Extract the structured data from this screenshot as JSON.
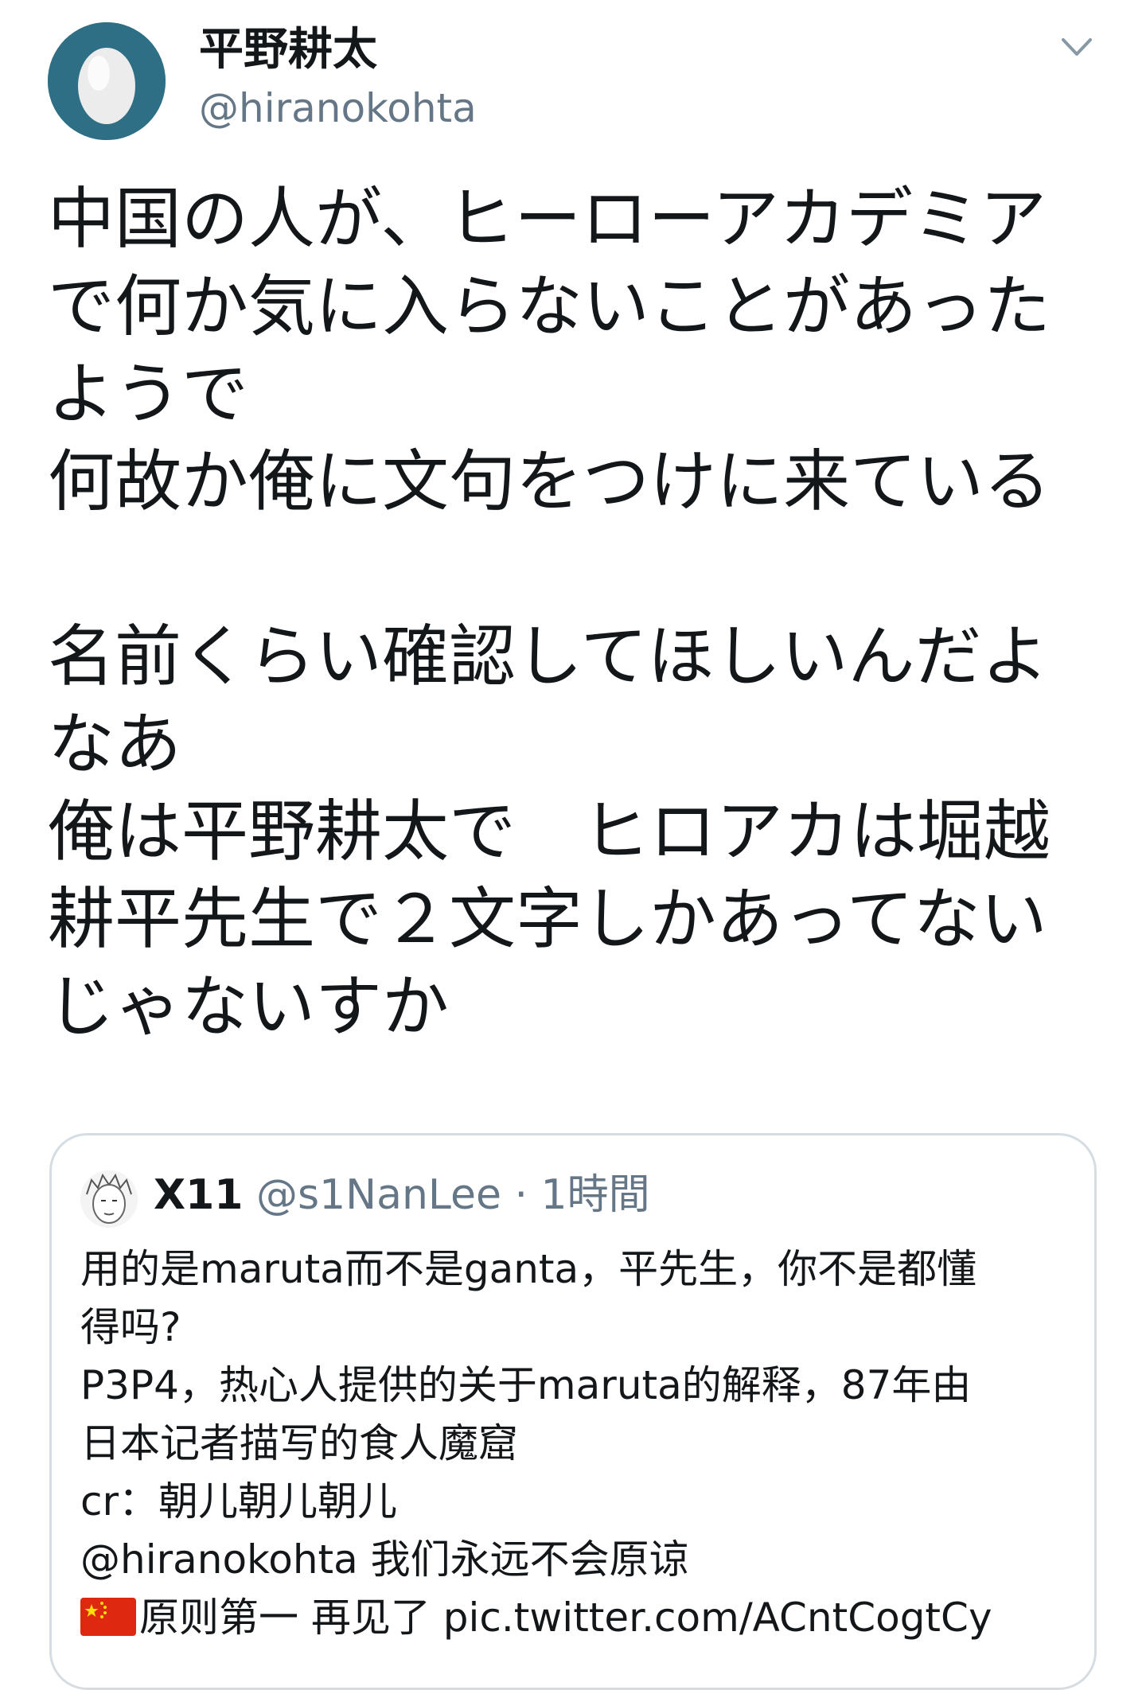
{
  "author": {
    "display_name": "平野耕太",
    "handle": "@hiranokohta",
    "avatar_icon": "default-egg-avatar-icon"
  },
  "menu_icon": "chevron-down-icon",
  "tweet_lines": [
    "中国の人が、ヒーローアカデミア",
    "で何か気に入らないことがあった",
    "ようで",
    "何故か俺に文句をつけに来ている",
    "",
    "名前くらい確認してほしいんだよ",
    "なあ",
    "俺は平野耕太で　ヒロアカは堀越",
    "耕平先生で２文字しかあってない",
    "じゃないすか"
  ],
  "quote": {
    "avatar_icon": "manga-character-avatar-icon",
    "name": "X11",
    "handle": "@s1NanLee",
    "separator": "·",
    "time": "1時間",
    "lines": [
      "用的是maruta而不是ganta，平先生，你不是都懂",
      "得吗?",
      "P3P4，热心人提供的关于maruta的解释，87年由",
      "日本记者描写的食人魔窟",
      "cr：朝儿朝儿朝儿",
      "@hiranokohta 我们永远不会原谅"
    ],
    "last_line_flag_icon": "china-flag-icon",
    "last_line_text": "原则第一 再见了 ",
    "link": "pic.twitter.com/ACntCogtCy"
  },
  "colors": {
    "text": "#14171a",
    "secondary": "#657786",
    "avatar_bg": "#2f6f86",
    "card_border": "#d5dde3"
  }
}
